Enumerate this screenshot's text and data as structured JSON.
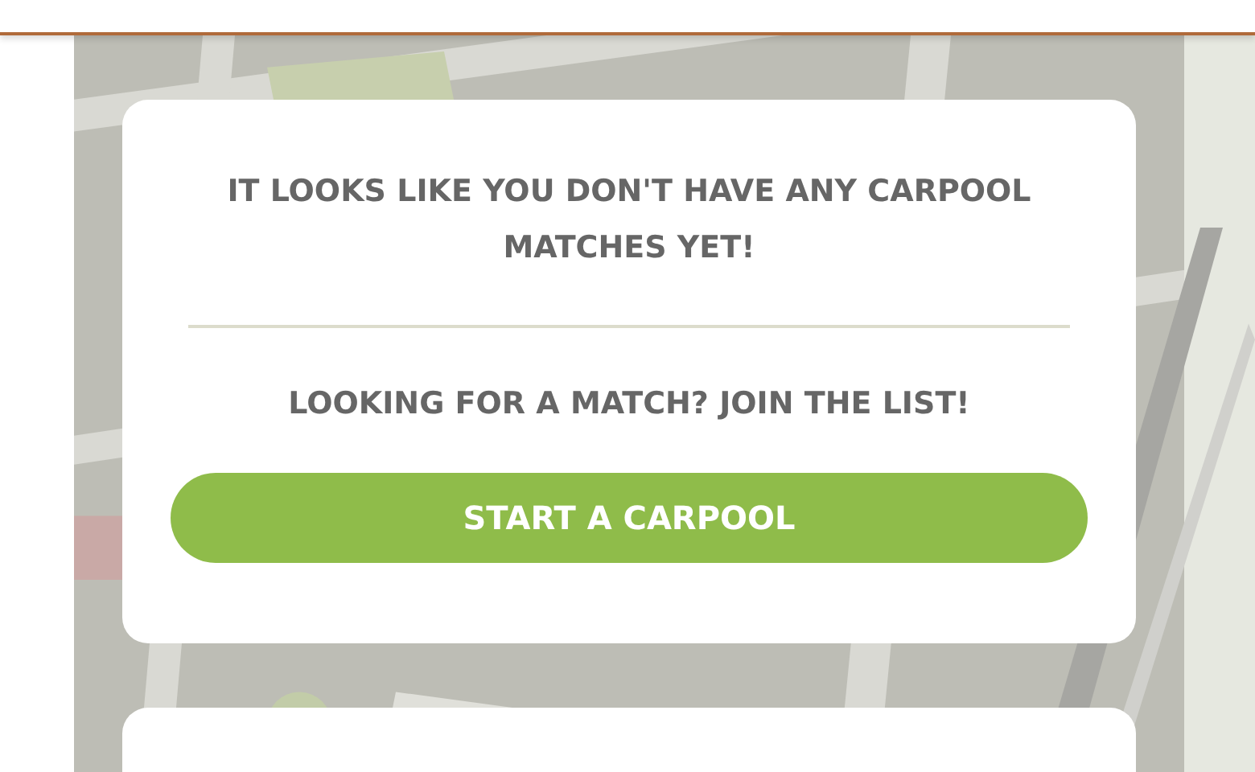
{
  "empty_state_card": {
    "message": "IT LOOKS LIKE YOU DON'T HAVE ANY CARPOOL MATCHES YET!",
    "prompt": "LOOKING FOR A MATCH? JOIN THE LIST!",
    "button": "START A CARPOOL"
  }
}
